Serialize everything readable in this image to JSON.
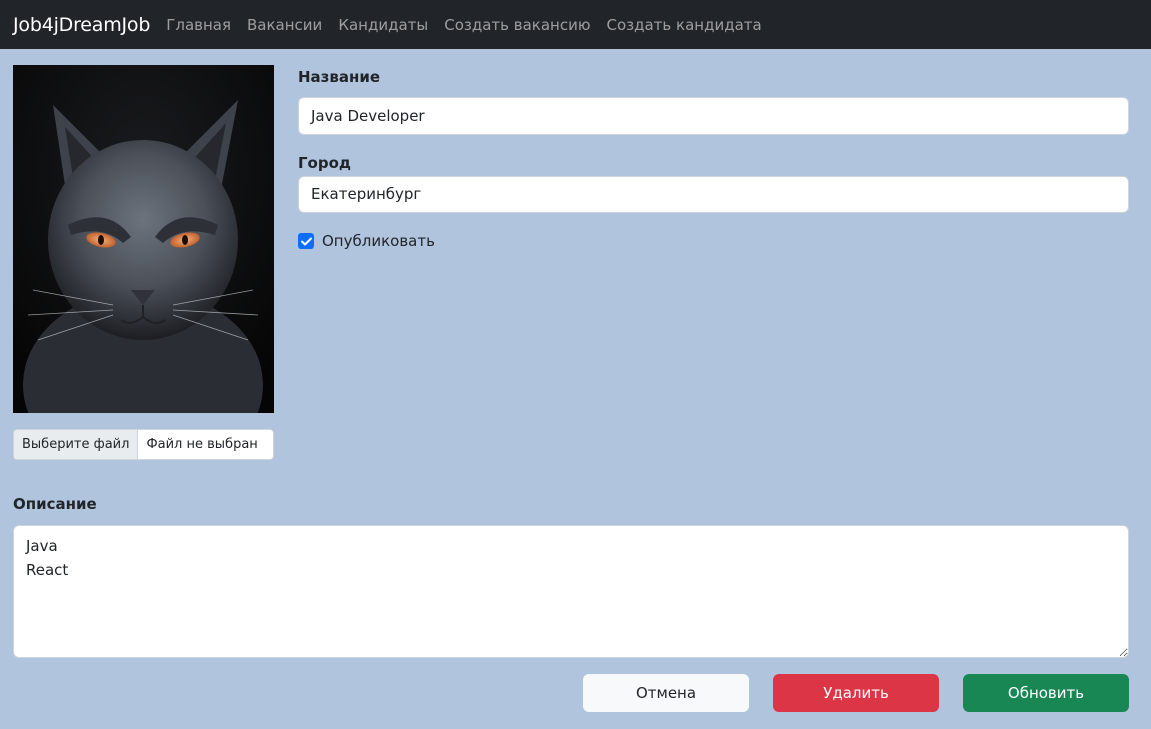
{
  "navbar": {
    "brand": "Job4jDreamJob",
    "links": [
      "Главная",
      "Вакансии",
      "Кандидаты",
      "Создать вакансию",
      "Создать кандидата"
    ]
  },
  "photo": {
    "icon": "cat-photo"
  },
  "file_input": {
    "button_label": "Выберите файл",
    "status": "Файл не выбран"
  },
  "form": {
    "title_label": "Название",
    "title_value": "Java Developer",
    "city_label": "Город",
    "city_value": "Екатеринбург",
    "publish_label": "Опубликовать",
    "publish_checked": true,
    "description_label": "Описание",
    "description_value": "Java\nReact"
  },
  "buttons": {
    "cancel": "Отмена",
    "delete": "Удалить",
    "update": "Обновить"
  },
  "colors": {
    "background": "#b0c4de",
    "navbar": "#212529",
    "primary": "#0d6efd",
    "danger": "#dc3545",
    "success": "#198754"
  }
}
